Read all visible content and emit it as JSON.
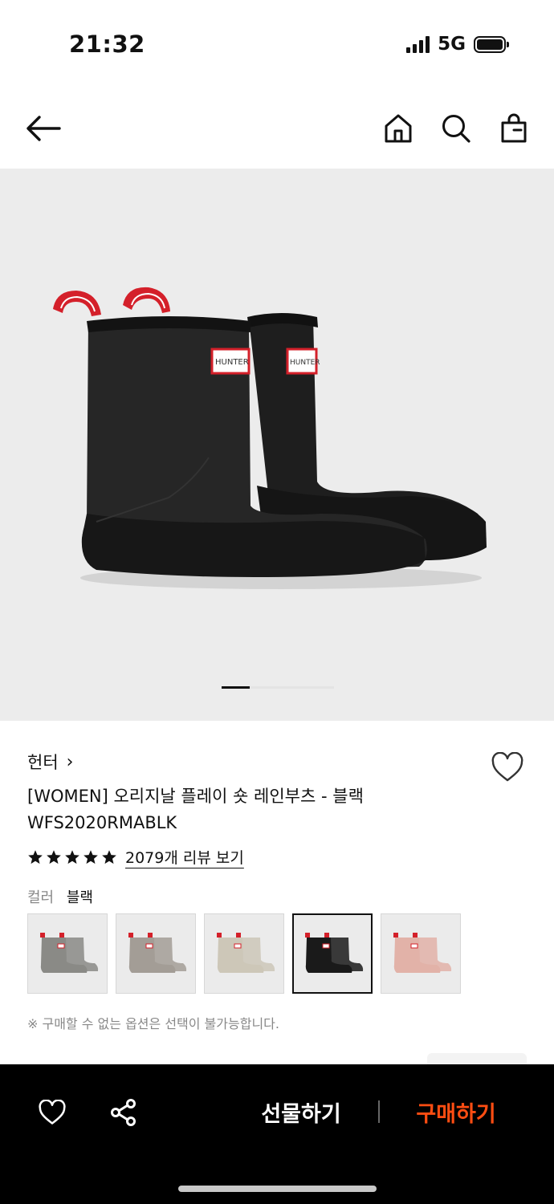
{
  "status_bar": {
    "time": "21:32",
    "network": "5G",
    "signal_bars": 4,
    "battery_level": 1.0
  },
  "nav": {
    "icons": [
      "arrow-left-icon",
      "home-icon",
      "search-icon",
      "shopping-bag-icon"
    ]
  },
  "gallery": {
    "current_page": 1,
    "page_count": 4
  },
  "product": {
    "brand": "헌터",
    "brand_chevron": "›",
    "name": "[WOMEN] 오리지날 플레이 숏 레인부츠 - 블랙",
    "code": "WFS2020RMABLK",
    "rating_stars": 5,
    "review_link": "2079개 리뷰 보기",
    "boot_logo_text": "HUNTER"
  },
  "color": {
    "label": "컬러",
    "selected": "블랙",
    "swatches": [
      {
        "color": "#8a8a86",
        "selected": false
      },
      {
        "color": "#a39d96",
        "selected": false
      },
      {
        "color": "#cdc7b8",
        "selected": false
      },
      {
        "color": "#1a1a1a",
        "selected": true
      },
      {
        "color": "#e2b2a8",
        "selected": false
      }
    ]
  },
  "notice": "※ 구매할 수 없는 옵션은 선택이 불가능합니다.",
  "bottom_bar": {
    "gift_label": "선물하기",
    "buy_label": "구매하기",
    "accent_color": "#ff4d12"
  }
}
